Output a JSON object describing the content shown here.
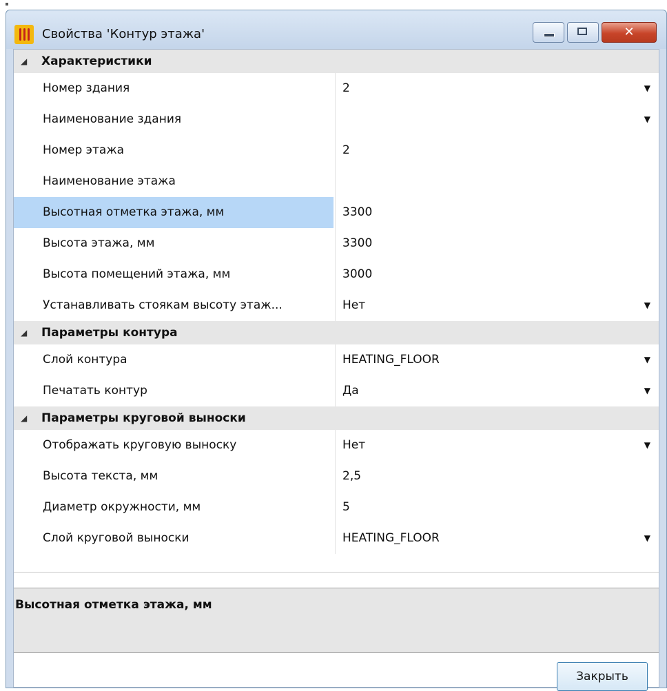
{
  "window": {
    "title": "Свойства 'Контур этажа'",
    "close_glyph": "✕"
  },
  "grid": {
    "categories": [
      {
        "label": "Характеристики",
        "arrow": "◢"
      },
      {
        "label": "Параметры контура",
        "arrow": "◢"
      },
      {
        "label": "Параметры круговой выноски",
        "arrow": "◢"
      }
    ],
    "rows": [
      {
        "name": "Номер здания",
        "value": "2",
        "dropdown": true
      },
      {
        "name": "Наименование здания",
        "value": "",
        "dropdown": true
      },
      {
        "name": "Номер этажа",
        "value": "2",
        "dropdown": false
      },
      {
        "name": "Наименование этажа",
        "value": "",
        "dropdown": false
      },
      {
        "name": "Высотная отметка этажа, мм",
        "value": "3300",
        "dropdown": false,
        "selected": true
      },
      {
        "name": "Высота этажа, мм",
        "value": "3300",
        "dropdown": false
      },
      {
        "name": "Высота помещений этажа, мм",
        "value": "3000",
        "dropdown": false
      },
      {
        "name": "Устанавливать стоякам высоту этаж...",
        "value": "Нет",
        "dropdown": true
      },
      {
        "name": "Слой контура",
        "value": "HEATING_FLOOR",
        "dropdown": true
      },
      {
        "name": "Печатать контур",
        "value": "Да",
        "dropdown": true
      },
      {
        "name": "Отображать круговую выноску",
        "value": "Нет",
        "dropdown": true
      },
      {
        "name": "Высота текста, мм",
        "value": "2,5",
        "dropdown": false
      },
      {
        "name": "Диаметр окружности, мм",
        "value": "5",
        "dropdown": false
      },
      {
        "name": "Слой круговой выноски",
        "value": "HEATING_FLOOR",
        "dropdown": true
      }
    ],
    "dropdown_glyph": "▼"
  },
  "description": {
    "title": "Высотная отметка этажа, мм"
  },
  "footer": {
    "close_label": "Закрыть"
  },
  "colors": {
    "selection": "#b7d7f7",
    "category_bg": "#e6e6e6",
    "close_button_red": "#c8452a"
  }
}
